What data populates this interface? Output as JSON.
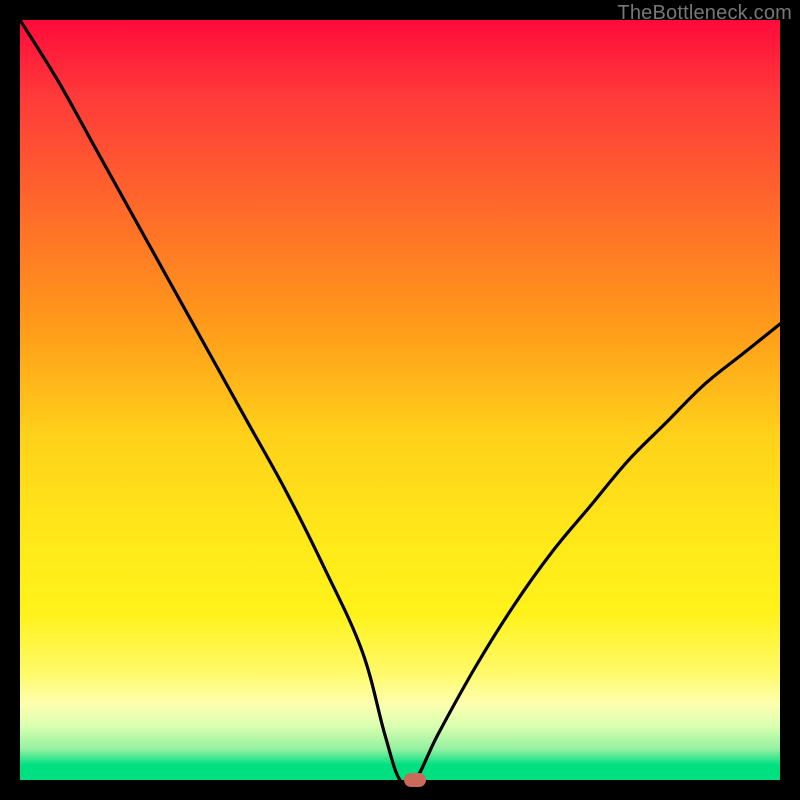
{
  "watermark": "TheBottleneck.com",
  "chart_data": {
    "type": "line",
    "title": "",
    "xlabel": "",
    "ylabel": "",
    "xlim": [
      0,
      100
    ],
    "ylim": [
      0,
      100
    ],
    "x": [
      0,
      5,
      10,
      15,
      20,
      25,
      30,
      35,
      40,
      45,
      48,
      50,
      52,
      55,
      60,
      65,
      70,
      75,
      80,
      85,
      90,
      95,
      100
    ],
    "y": [
      100,
      92,
      83,
      74,
      65,
      56,
      47,
      38,
      28,
      17,
      6,
      0,
      0,
      6,
      15,
      23,
      30,
      36,
      42,
      47,
      52,
      56,
      60
    ],
    "marker": {
      "x": 52,
      "y": 0
    },
    "gradient_colors": {
      "top": "#ff0a3a",
      "mid_upper": "#ff9a1a",
      "mid": "#ffe81a",
      "mid_lower": "#fdffb0",
      "bottom": "#00e080"
    },
    "curve_color": "#000000"
  }
}
